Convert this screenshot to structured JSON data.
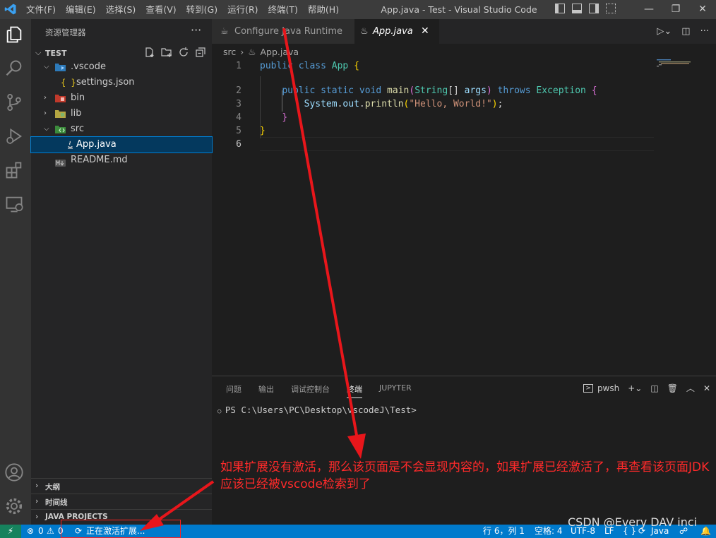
{
  "titlebar": {
    "menus": [
      "文件(F)",
      "编辑(E)",
      "选择(S)",
      "查看(V)",
      "转到(G)",
      "运行(R)",
      "终端(T)",
      "帮助(H)"
    ],
    "title": "App.java - Test - Visual Studio Code"
  },
  "sidebar": {
    "title": "资源管理器",
    "more": "···",
    "section": "TEST",
    "tree": [
      {
        "label": ".vscode",
        "icon": "vscode-folder-icon"
      },
      {
        "label": "settings.json",
        "icon": "json-braces-icon"
      },
      {
        "label": "bin",
        "icon": "bin-folder-icon"
      },
      {
        "label": "lib",
        "icon": "lib-folder-icon"
      },
      {
        "label": "src",
        "icon": "src-folder-icon"
      },
      {
        "label": "App.java",
        "icon": "java-file-icon"
      },
      {
        "label": "README.md",
        "icon": "markdown-file-icon"
      }
    ],
    "bottom_sections": [
      "大纲",
      "时间线",
      "JAVA PROJECTS"
    ]
  },
  "tabs": [
    {
      "label": "Configure Java Runtime",
      "icon": "coffee-icon"
    },
    {
      "label": "App.java",
      "icon": "java-file-icon",
      "close": "✕"
    }
  ],
  "breadcrumb": {
    "folder": "src",
    "sep": "›",
    "file": "App.java"
  },
  "code": {
    "line_numbers": [
      "1",
      "2",
      "3",
      "4",
      "5",
      "6"
    ]
  },
  "panel": {
    "tabs": [
      "问题",
      "输出",
      "调试控制台",
      "终端",
      "JUPYTER"
    ],
    "active_tab": "终端",
    "shell": "pwsh",
    "prompt": "PS C:\\Users\\PC\\Desktop\\vscodeJ\\Test>"
  },
  "annotation": {
    "text": "如果扩展没有激活，那么该页面是不会显现内容的，如果扩展已经激活了，再查看该页面JDK应该已经被vscode检索到了",
    "watermark": "CSDN @Every DAV inci"
  },
  "statusbar": {
    "errors": "0",
    "warnings": "0",
    "activating": "正在激活扩展...",
    "position": "行 6，列 1",
    "spaces": "空格: 4",
    "encoding": "UTF-8",
    "eol": "LF",
    "language_braces": "{ }",
    "language": "Java"
  },
  "colors": {
    "statusbar": "#007acc",
    "remote": "#16825d",
    "annotation": "#ff2a2a",
    "selection": "#04395e"
  }
}
